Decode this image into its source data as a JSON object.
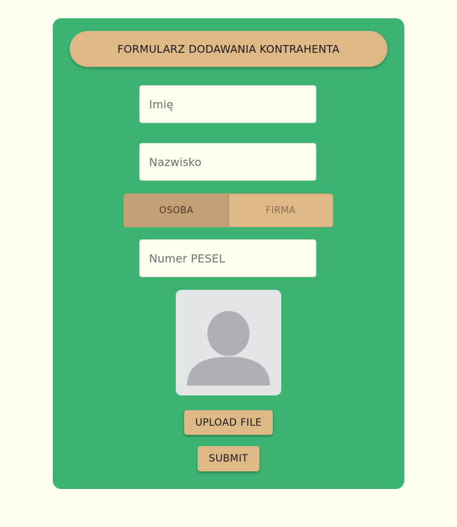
{
  "form": {
    "title": "FORMULARZ DODAWANIA KONTRAHENTA",
    "first_name_placeholder": "Imię",
    "last_name_placeholder": "Nazwisko",
    "type_toggle": {
      "options": [
        "OSOBA",
        "FIRMA"
      ],
      "selected": "OSOBA"
    },
    "pesel_placeholder": "Numer PESEL",
    "avatar_icon": "person-placeholder-icon",
    "upload_label": "UPLOAD FILE",
    "submit_label": "SUBMIT"
  },
  "colors": {
    "page_background": "#fffff0",
    "card_background": "#3cb371",
    "accent": "#deb887",
    "accent_selected": "#c49f75",
    "avatar_background": "#e4e5e7",
    "avatar_figure": "#adb0b4"
  }
}
